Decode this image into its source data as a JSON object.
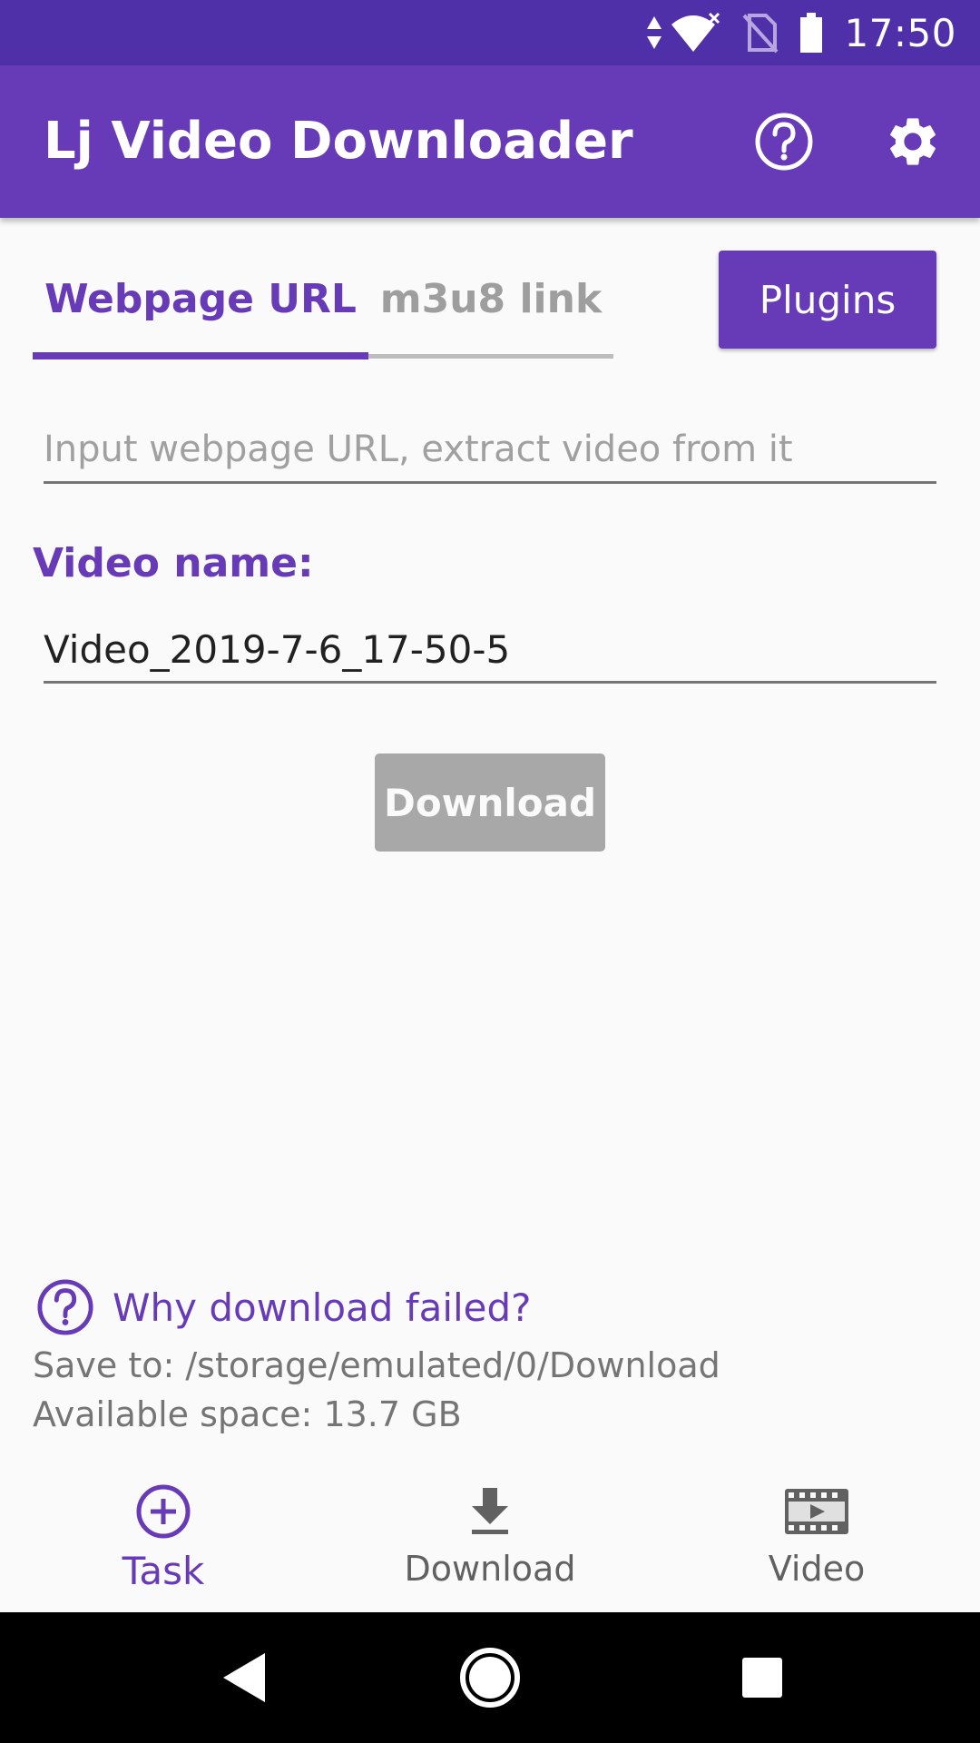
{
  "status_bar": {
    "time": "17:50",
    "icons": [
      "data-arrows-icon",
      "wifi-icon",
      "no-sim-icon",
      "battery-icon"
    ],
    "color": "#5030a8"
  },
  "app_bar": {
    "title": "Lj Video Downloader",
    "icons": [
      "help-icon",
      "settings-icon"
    ],
    "color": "#673ab7"
  },
  "tabs": [
    {
      "label": "Webpage URL",
      "selected": true
    },
    {
      "label": "m3u8 link",
      "selected": false
    }
  ],
  "plugins_button": {
    "label": "Plugins"
  },
  "url_input": {
    "value": "",
    "placeholder": "Input webpage URL, extract video from it"
  },
  "video_name": {
    "label": "Video name:",
    "value": "Video_2019-7-6_17-50-5"
  },
  "download_button": {
    "label": "Download",
    "enabled": false
  },
  "help_link": {
    "label": "Why download failed?",
    "icon": "help-circle-icon"
  },
  "save_to": "Save to: /storage/emulated/0/Download",
  "available_space": "Available space: 13.7 GB",
  "bottom_nav": [
    {
      "label": "Task",
      "icon": "add-circle-icon",
      "selected": true
    },
    {
      "label": "Download",
      "icon": "download-icon",
      "selected": false
    },
    {
      "label": "Video",
      "icon": "video-film-icon",
      "selected": false
    }
  ],
  "system_nav": [
    "back-icon",
    "home-icon",
    "recents-icon"
  ],
  "accent_color": "#673ab7"
}
